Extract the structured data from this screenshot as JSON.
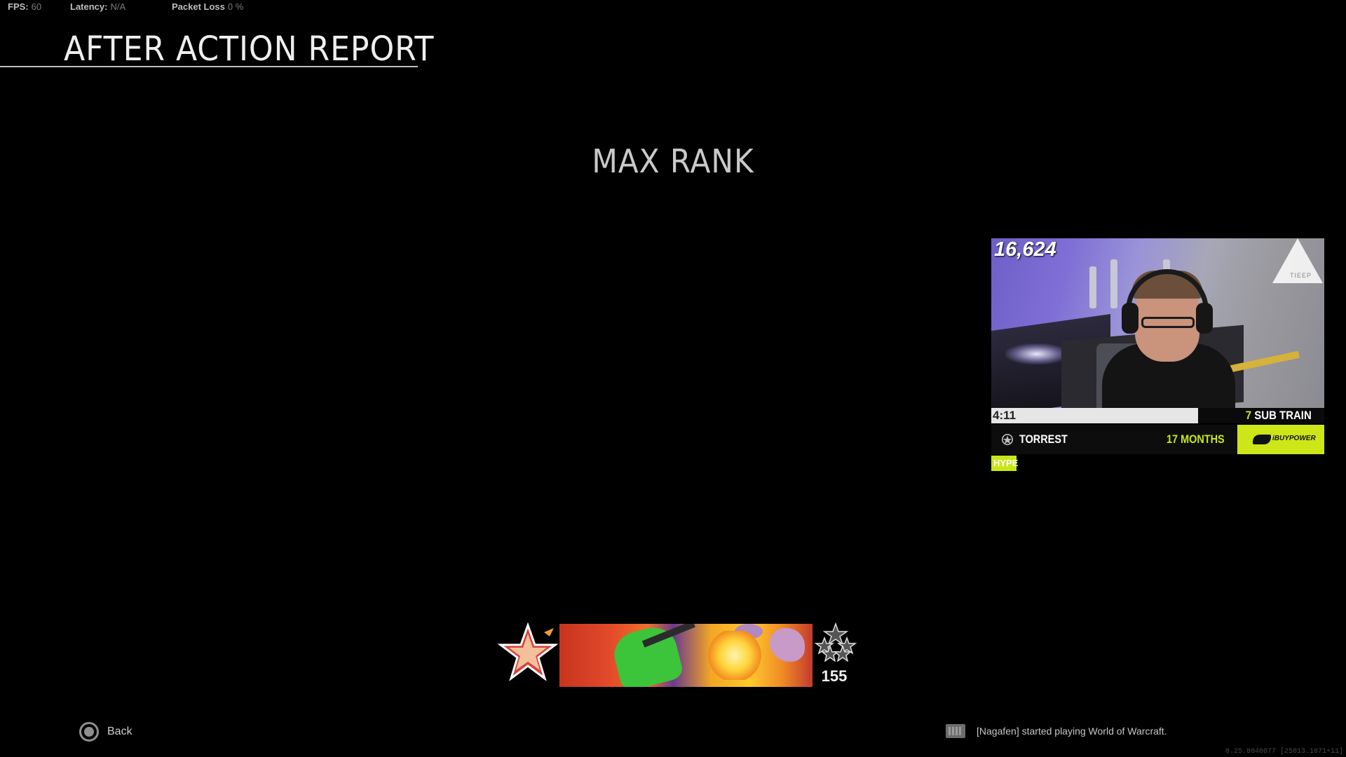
{
  "stats": {
    "fps_label": "FPS:",
    "fps_value": "60",
    "latency_label": "Latency:",
    "latency_value": "N/A",
    "packet_loss_label": "Packet Loss",
    "packet_loss_value": "0 %"
  },
  "page": {
    "title": "AFTER ACTION REPORT",
    "headline": "MAX RANK"
  },
  "stream_overlay": {
    "viewer_count": "16,624",
    "timer": "4:11",
    "timer_progress_fraction": 0.62,
    "sub_train_count": "7",
    "sub_train_label": "SUB TRAIN",
    "subscriber_name": "TORREST",
    "subscriber_duration": "17 MONTHS",
    "hype_label": "HYPE",
    "corner_logo_text": "TIEEP",
    "sponsor_text": "iBUYPOWER",
    "accent_color": "#c8e619"
  },
  "rank": {
    "prestige_level": "155",
    "emblem_icon": "rank-star-emblem",
    "prestige_icon": "prestige-stars"
  },
  "footer": {
    "back_label": "Back",
    "back_icon": "circle-button-icon",
    "notification_icon": "keyboard-icon",
    "notification_text": "[Nagafen] started playing World of Warcraft.",
    "build_string": "8.25.8046077 [25013.1071+11]"
  }
}
